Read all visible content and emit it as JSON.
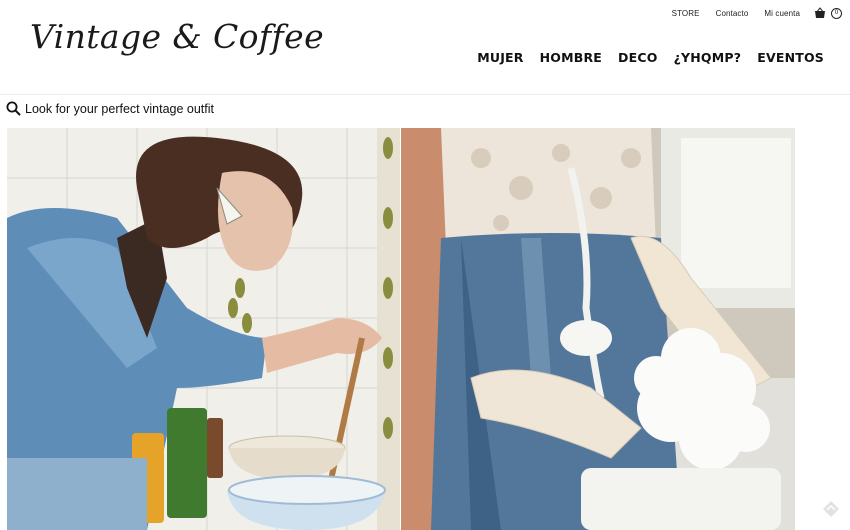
{
  "utility": {
    "store": "STORE",
    "contact": "Contacto",
    "account": "Mi cuenta",
    "cart_count": "0"
  },
  "logo": {
    "text": "Vintage & Coffee"
  },
  "nav": [
    "MUJER",
    "HOMBRE",
    "DECO",
    "¿YHQMP?",
    "EVENTOS"
  ],
  "search": {
    "text": "Look for your perfect vintage outfit"
  },
  "colors": {
    "text": "#111111",
    "divider": "#ececec"
  },
  "icons": {
    "search": "search-icon",
    "cart": "shopping-basket-icon",
    "scroll": "scroll-to-top-icon"
  }
}
